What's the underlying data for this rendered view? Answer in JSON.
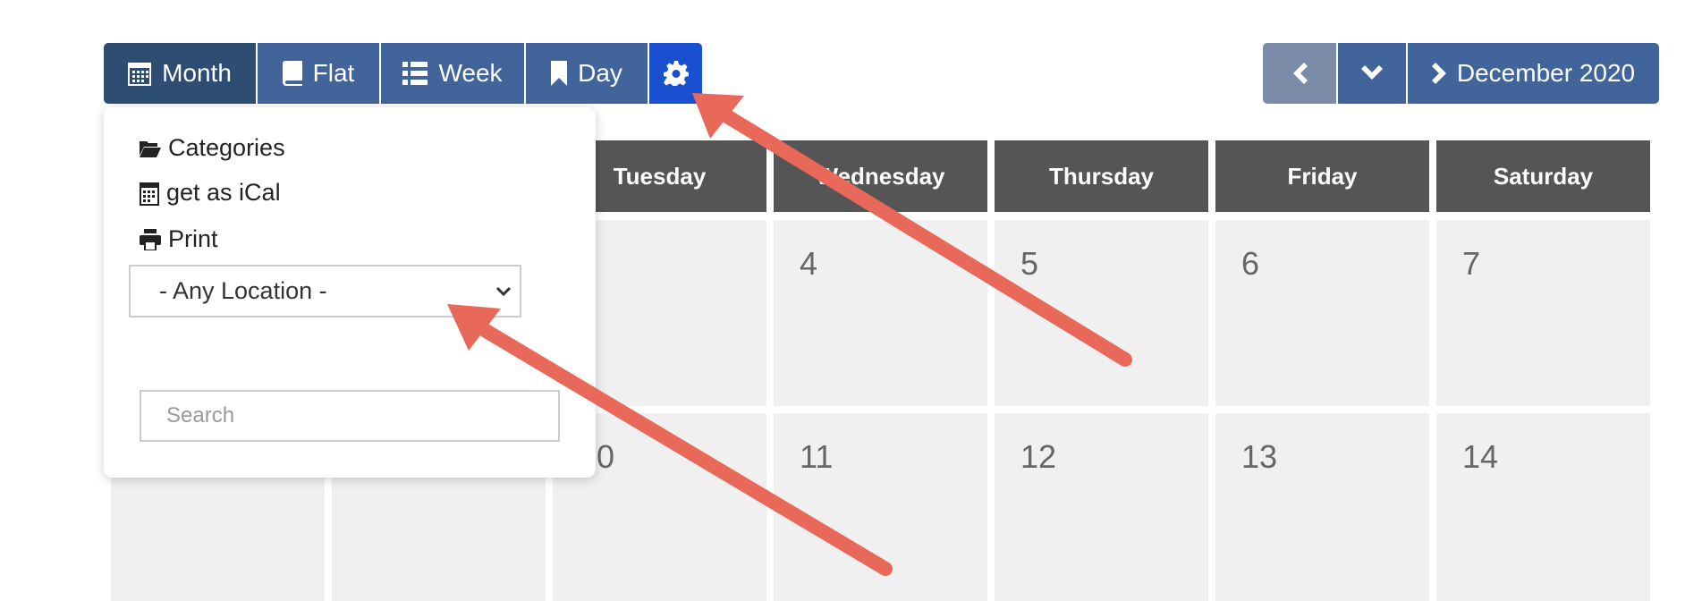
{
  "view_tabs": [
    {
      "label": "Month",
      "icon": "calendar-icon",
      "active": true
    },
    {
      "label": "Flat",
      "icon": "book-icon"
    },
    {
      "label": "Week",
      "icon": "list-icon"
    },
    {
      "label": "Day",
      "icon": "bookmark-icon"
    }
  ],
  "settings_icon": "gear-icon",
  "nav": {
    "prev_icon": "chevron-left-icon",
    "jump_icon": "chevron-down-icon",
    "next_icon": "chevron-right-icon",
    "next_label": "December 2020"
  },
  "weekdays": [
    "",
    "",
    "Tuesday",
    "Wednesday",
    "Thursday",
    "Friday",
    "Saturday"
  ],
  "weeks": [
    [
      "",
      "",
      "",
      "4",
      "5",
      "6",
      "7"
    ],
    [
      "",
      "",
      "10",
      "11",
      "12",
      "13",
      "14"
    ]
  ],
  "popup": {
    "items": [
      {
        "label": "Categories",
        "icon": "folder-open-icon"
      },
      {
        "label": "get as iCal",
        "icon": "calendar-icon"
      },
      {
        "label": "Print",
        "icon": "print-icon"
      }
    ],
    "location_select": "- Any Location -",
    "search_placeholder": "Search"
  },
  "colors": {
    "active_tab": "#2e4d72",
    "tab": "#41659a",
    "settings": "#1a4fd0",
    "prev": "#7a8ca7",
    "header": "#555555",
    "cell": "#f0f0f0",
    "annotation_arrow": "#e8685a"
  }
}
